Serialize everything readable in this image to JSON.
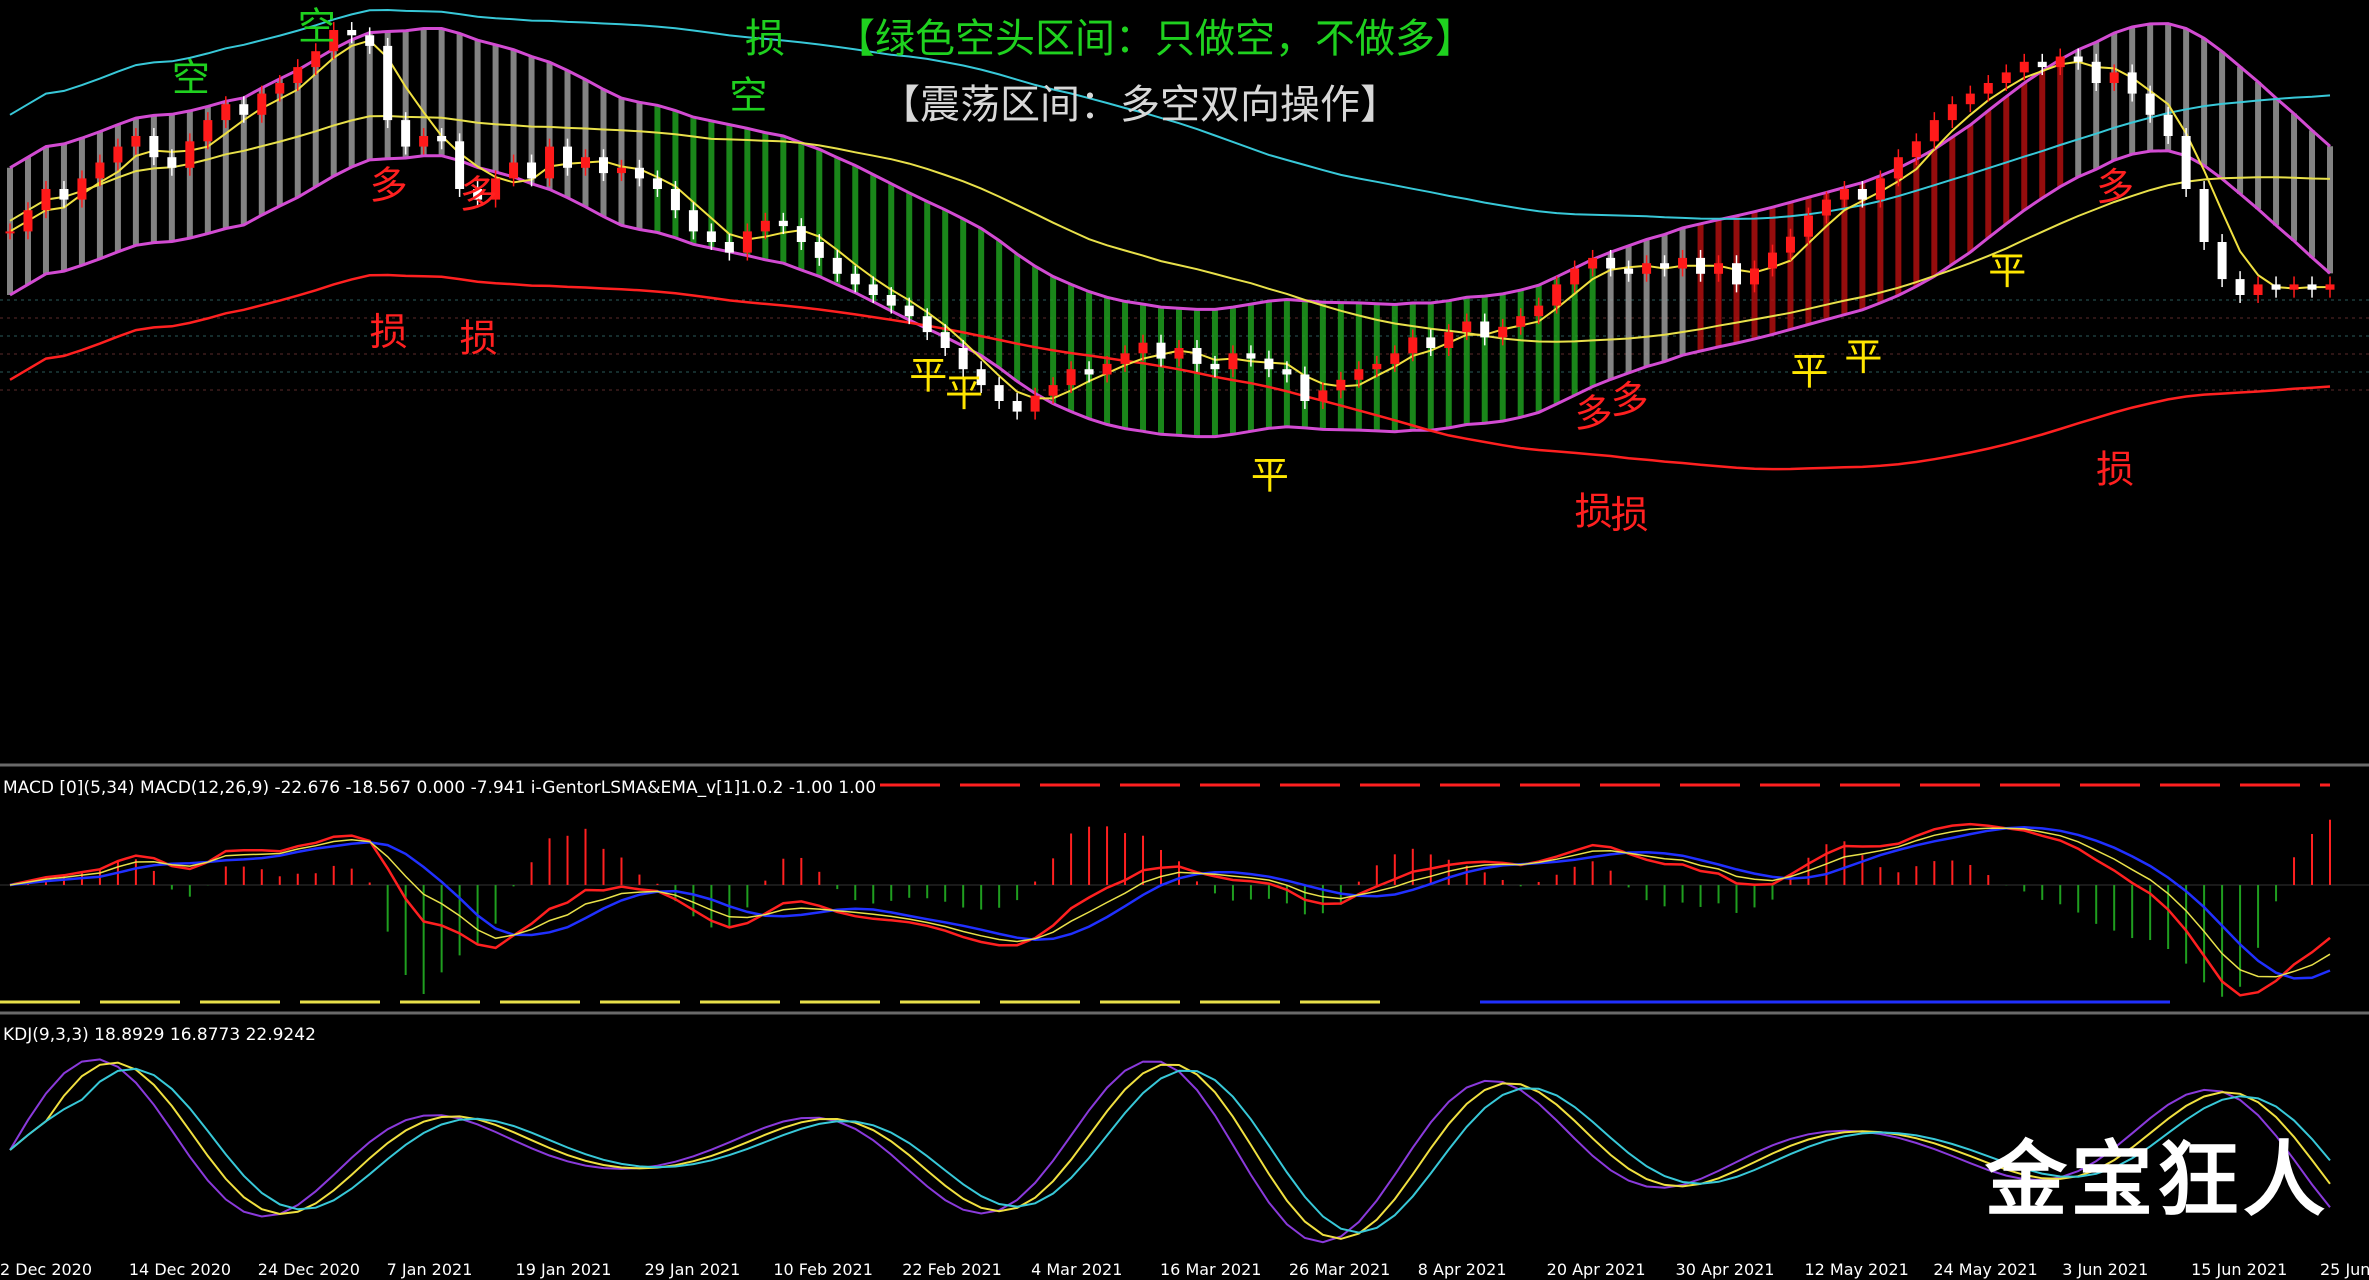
{
  "header": {
    "signal_loss": "损",
    "green_zone_note": "【绿色空头区间：只做空，不做多】",
    "range_zone_note": "【震荡区间：多空双向操作】"
  },
  "watermark": "金宝狂人",
  "colors": {
    "background": "#000000",
    "up_candle": "#ff1a1a",
    "down_candle": "#ffffff",
    "channel": "#d24bd2",
    "bear_band": "#1f9e1f",
    "bull_band": "#b01010",
    "neutral_band": "#9a9a9a",
    "slow_ma": "#ff2020",
    "mid_ma": "#e8e04a",
    "upper_ma": "#38c8d8",
    "fast_ma": "#f0e040",
    "macd_fast": "#ff2020",
    "macd_slow": "#2030ff",
    "kdj_k": "#f0e040",
    "kdj_d": "#38c8d8",
    "kdj_j": "#8a3adb"
  },
  "chart_data": [
    {
      "type": "candlestick",
      "panel": "main",
      "x_labels": [
        "2 Dec 2020",
        "14 Dec 2020",
        "24 Dec 2020",
        "7 Jan 2021",
        "19 Jan 2021",
        "29 Jan 2021",
        "10 Feb 2021",
        "22 Feb 2021",
        "4 Mar 2021",
        "16 Mar 2021",
        "26 Mar 2021",
        "8 Apr 2021",
        "20 Apr 2021",
        "30 Apr 2021",
        "12 May 2021",
        "24 May 2021",
        "3 Jun 2021",
        "15 Jun 2021",
        "25 Jun"
      ],
      "close": [
        0.62,
        0.66,
        0.7,
        0.68,
        0.72,
        0.75,
        0.78,
        0.8,
        0.76,
        0.74,
        0.79,
        0.83,
        0.86,
        0.84,
        0.88,
        0.9,
        0.93,
        0.96,
        1.0,
        0.99,
        0.97,
        0.83,
        0.78,
        0.8,
        0.79,
        0.7,
        0.68,
        0.72,
        0.75,
        0.72,
        0.78,
        0.74,
        0.76,
        0.73,
        0.74,
        0.72,
        0.7,
        0.66,
        0.62,
        0.6,
        0.58,
        0.62,
        0.64,
        0.63,
        0.6,
        0.57,
        0.54,
        0.52,
        0.5,
        0.48,
        0.46,
        0.43,
        0.4,
        0.36,
        0.33,
        0.3,
        0.28,
        0.31,
        0.33,
        0.36,
        0.35,
        0.37,
        0.39,
        0.41,
        0.38,
        0.4,
        0.37,
        0.36,
        0.39,
        0.38,
        0.36,
        0.35,
        0.3,
        0.32,
        0.34,
        0.36,
        0.37,
        0.39,
        0.42,
        0.4,
        0.43,
        0.45,
        0.42,
        0.44,
        0.46,
        0.48,
        0.52,
        0.55,
        0.57,
        0.55,
        0.54,
        0.56,
        0.55,
        0.57,
        0.54,
        0.56,
        0.52,
        0.55,
        0.58,
        0.61,
        0.65,
        0.68,
        0.7,
        0.68,
        0.72,
        0.76,
        0.79,
        0.83,
        0.86,
        0.88,
        0.9,
        0.92,
        0.94,
        0.93,
        0.95,
        0.94,
        0.9,
        0.92,
        0.88,
        0.84,
        0.8,
        0.7,
        0.6,
        0.53,
        0.5,
        0.52,
        0.51,
        0.52,
        0.51,
        0.52
      ],
      "annotations": [
        {
          "label": "空",
          "color": "#1fd11f",
          "at": 17
        },
        {
          "label": "空",
          "color": "#1fd11f",
          "at": 10
        },
        {
          "label": "空",
          "color": "#1fd11f",
          "at": 41
        },
        {
          "label": "多",
          "color": "#ff2020",
          "at": 21
        },
        {
          "label": "多",
          "color": "#ff2020",
          "at": 26
        },
        {
          "label": "损",
          "color": "#ff2020",
          "at": 21
        },
        {
          "label": "损",
          "color": "#ff2020",
          "at": 26
        },
        {
          "label": "平",
          "color": "#ffe600",
          "at": 51
        },
        {
          "label": "平",
          "color": "#ffe600",
          "at": 53
        },
        {
          "label": "平",
          "color": "#ffe600",
          "at": 70
        },
        {
          "label": "多",
          "color": "#ff2020",
          "at": 88
        },
        {
          "label": "多",
          "color": "#ff2020",
          "at": 90
        },
        {
          "label": "损",
          "color": "#ff2020",
          "at": 88
        },
        {
          "label": "损",
          "color": "#ff2020",
          "at": 90
        },
        {
          "label": "平",
          "color": "#ffe600",
          "at": 100
        },
        {
          "label": "平",
          "color": "#ffe600",
          "at": 103
        },
        {
          "label": "平",
          "color": "#ffe600",
          "at": 111
        },
        {
          "label": "多",
          "color": "#ff2020",
          "at": 117
        },
        {
          "label": "损",
          "color": "#ff2020",
          "at": 117
        }
      ]
    },
    {
      "type": "line",
      "panel": "macd",
      "label": "MACD [0](5,34)  MACD(12,26,9) -22.676 -18.567 0.000 -7.941  i-GentorLSMA&EMA_v[1]1.0.2 -1.00 1.00"
    },
    {
      "type": "line",
      "panel": "kdj",
      "label": "KDJ(9,3,3) 18.8929 16.8773 22.9242"
    }
  ]
}
